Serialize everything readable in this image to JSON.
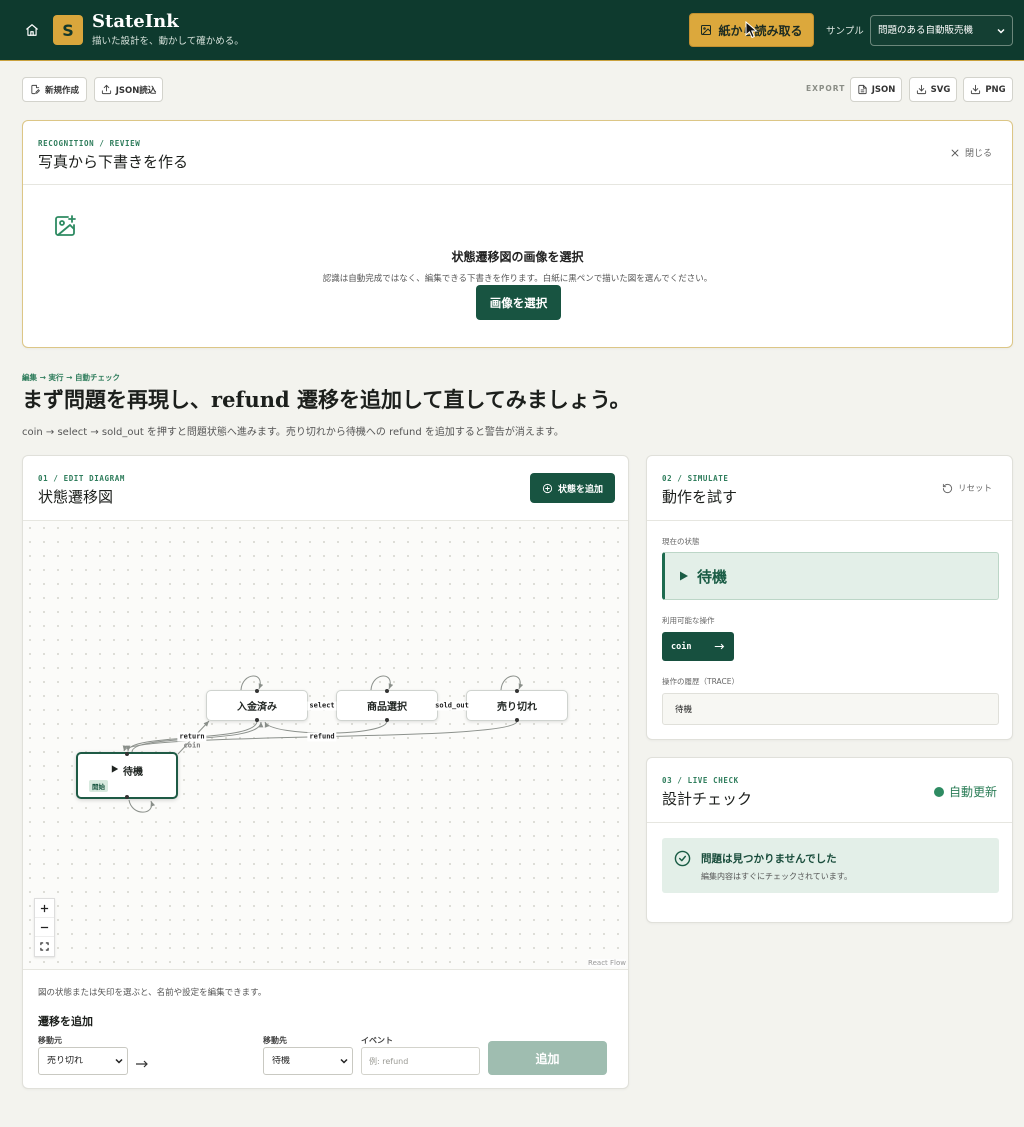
{
  "header": {
    "logo_letter": "S",
    "app_name": "StateInk",
    "tagline": "描いた設計を、動かして確かめる。",
    "scan_button": "紙から読み取る",
    "sample_label": "サンプル",
    "sample_selected": "問題のある自動販売機"
  },
  "toolbar": {
    "new_label": "新規作成",
    "import_label": "JSON読込",
    "export_label": "EXPORT",
    "export_json": "JSON",
    "export_svg": "SVG",
    "export_png": "PNG"
  },
  "recognition": {
    "eyebrow": "RECOGNITION / REVIEW",
    "title": "写真から下書きを作る",
    "close_label": "閉じる",
    "drop_title": "状態遷移図の画像を選択",
    "drop_description": "認識は自動完成ではなく、編集できる下書きを作ります。白紙に黒ペンで描いた図を選んでください。",
    "select_button": "画像を選択"
  },
  "intro": {
    "steps": "編集 → 実行 → 自動チェック",
    "heading": "まず問題を再現し、refund 遷移を追加して直してみましょう。",
    "description": "coin → select → sold_out を押すと問題状態へ進みます。売り切れから待機への refund を追加すると警告が消えます。"
  },
  "editor": {
    "eyebrow": "01 / EDIT DIAGRAM",
    "title": "状態遷移図",
    "add_state_button": "状態を追加",
    "states": [
      {
        "name": "待機",
        "initial": true,
        "badge": "開始"
      },
      {
        "name": "入金済み"
      },
      {
        "name": "商品選択"
      },
      {
        "name": "売り切れ"
      }
    ],
    "transitions": [
      {
        "event": "select"
      },
      {
        "event": "sold_out"
      },
      {
        "event": "return"
      },
      {
        "event": "coin"
      },
      {
        "event": "refund"
      }
    ],
    "attribution": "React Flow",
    "hint": "図の状態または矢印を選ぶと、名前や設定を編集できます。",
    "add_transition": {
      "title": "遷移を追加",
      "from_label": "移動元",
      "from_value": "売り切れ",
      "to_label": "移動先",
      "to_value": "待機",
      "event_label": "イベント",
      "event_placeholder": "例: refund",
      "submit_label": "追加",
      "submit_enabled": false
    }
  },
  "simulate": {
    "eyebrow": "02 / SIMULATE",
    "title": "動作を試す",
    "reset_label": "リセット",
    "current_state_label": "現在の状態",
    "current_state": "待機",
    "actions_label": "利用可能な操作",
    "actions": [
      {
        "event": "coin"
      }
    ],
    "trace_label": "操作の履歴（TRACE）",
    "trace": [
      "待機"
    ]
  },
  "live_check": {
    "eyebrow": "03 / LIVE CHECK",
    "title": "設計チェック",
    "auto_update_label": "自動更新",
    "result_title": "問題は見つかりませんでした",
    "result_description": "編集内容はすぐにチェックされています。"
  },
  "icons": {
    "home": "home-icon",
    "scan": "scan-image-icon",
    "new": "file-edit-icon",
    "import": "upload-icon",
    "export_json": "file-json-icon",
    "export_svg": "download-icon",
    "export_png": "download-icon",
    "close": "close-icon",
    "image_add": "image-plus-icon",
    "add_state": "plus-circle-icon",
    "reset": "rotate-ccw-icon",
    "check": "check-circle-icon",
    "start": "play-triangle-icon"
  },
  "colors": {
    "header_bg": "#0e3a2e",
    "accent": "#dca83c",
    "primary": "#185441",
    "success": "#2e8b62",
    "page_bg": "#f3f3ee"
  }
}
